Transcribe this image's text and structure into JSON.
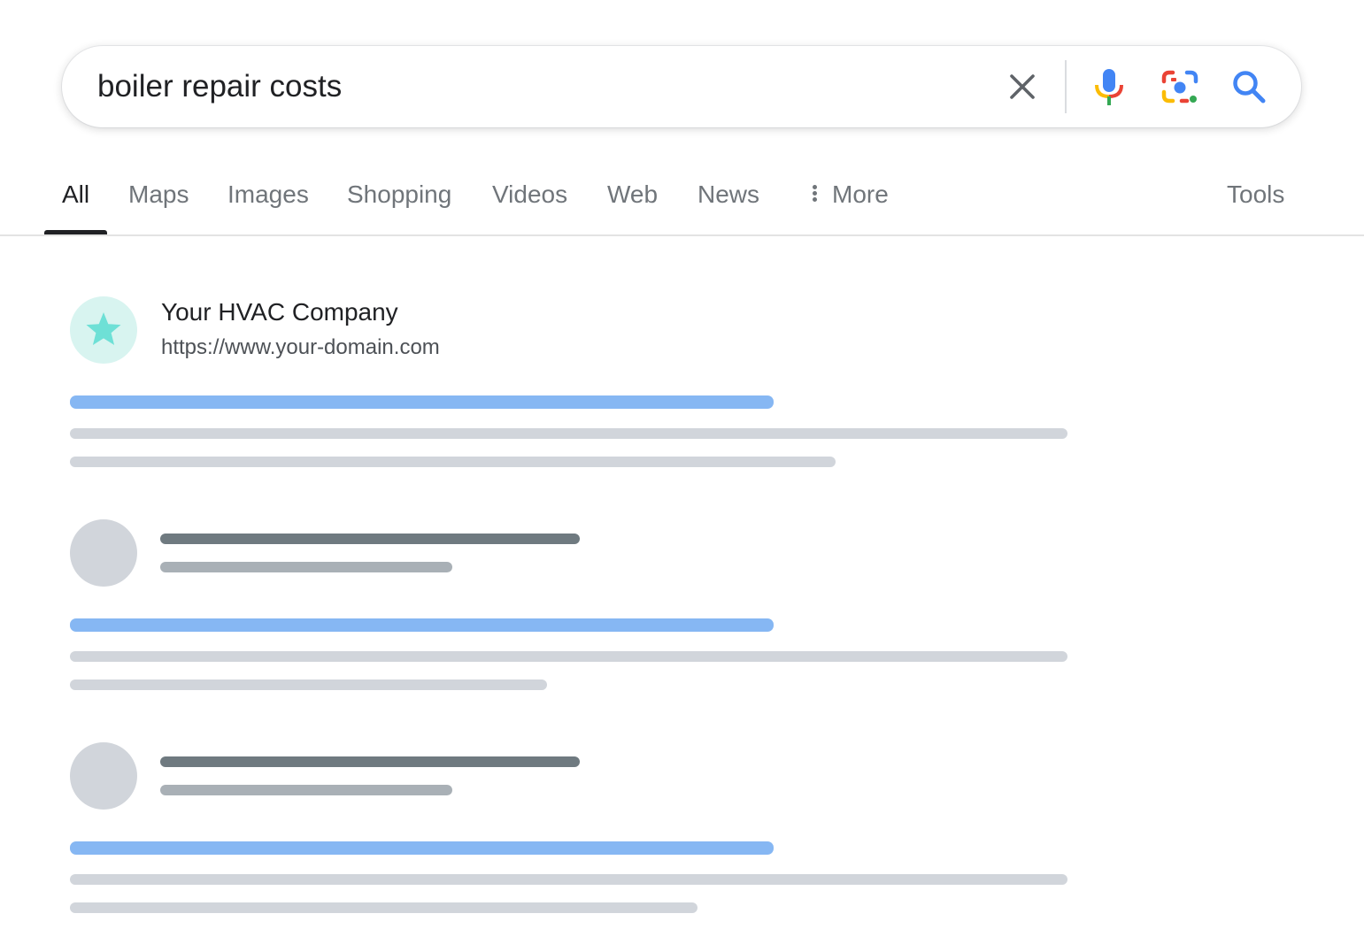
{
  "search": {
    "query": "boiler repair costs",
    "icons": {
      "clear": "close-icon",
      "voice": "microphone-icon",
      "lens": "lens-camera-icon",
      "search": "magnifier-icon"
    }
  },
  "tabs": [
    {
      "label": "All",
      "active": true
    },
    {
      "label": "Maps",
      "active": false
    },
    {
      "label": "Images",
      "active": false
    },
    {
      "label": "Shopping",
      "active": false
    },
    {
      "label": "Videos",
      "active": false
    },
    {
      "label": "Web",
      "active": false
    },
    {
      "label": "News",
      "active": false
    },
    {
      "label": "More",
      "active": false
    }
  ],
  "tools_label": "Tools",
  "results": [
    {
      "site_name": "Your HVAC Company",
      "url": "https://www.your-domain.com",
      "favicon": "star-icon",
      "favicon_color": "#6ee0d6"
    }
  ],
  "colors": {
    "link_placeholder": "#86b7f3",
    "text_placeholder": "#d1d5db",
    "title_placeholder": "#6f7a80",
    "favicon_bg": "#d8f4f0"
  }
}
